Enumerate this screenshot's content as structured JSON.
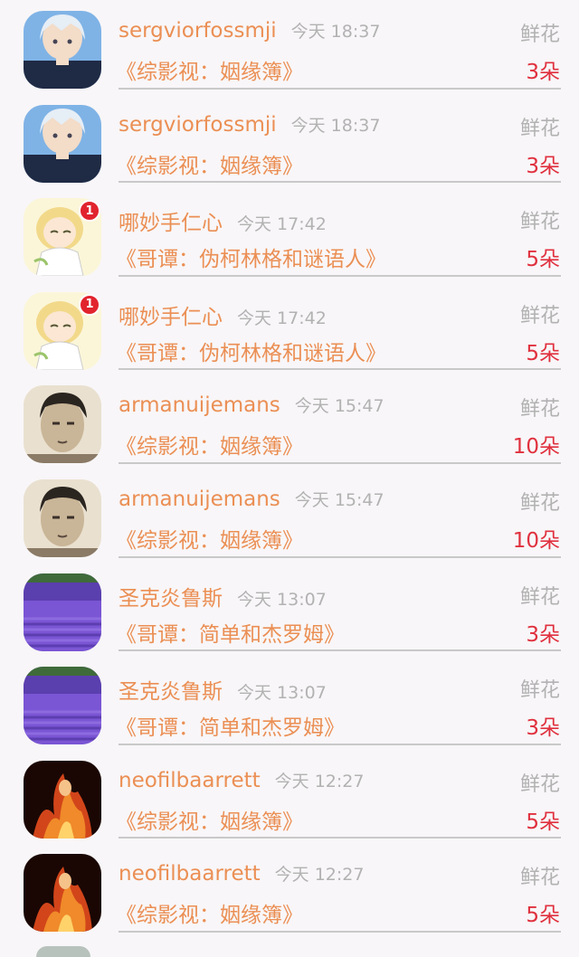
{
  "rows": [
    {
      "username": "sergviorfossmji",
      "time": "今天 18:37",
      "gift": "鲜花",
      "title": "《综影视：姻缘簿》",
      "count": "3朵",
      "avatar": "anime-boy-avatar"
    },
    {
      "username": "sergviorfossmji",
      "time": "今天 18:37",
      "gift": "鲜花",
      "title": "《综影视：姻缘簿》",
      "count": "3朵",
      "avatar": "anime-boy-avatar"
    },
    {
      "username": "哪妙手仁心",
      "time": "今天 17:42",
      "gift": "鲜花",
      "title": "《哥谭：伪柯林格和谜语人》",
      "count": "5朵",
      "avatar": "anime-girl-avatar",
      "badge": "1"
    },
    {
      "username": "哪妙手仁心",
      "time": "今天 17:42",
      "gift": "鲜花",
      "title": "《哥谭：伪柯林格和谜语人》",
      "count": "5朵",
      "avatar": "anime-girl-avatar",
      "badge": "1"
    },
    {
      "username": "armanuijemans",
      "time": "今天 15:47",
      "gift": "鲜花",
      "title": "《综影视：姻缘簿》",
      "count": "10朵",
      "avatar": "sketch-portrait-avatar"
    },
    {
      "username": "armanuijemans",
      "time": "今天 15:47",
      "gift": "鲜花",
      "title": "《综影视：姻缘簿》",
      "count": "10朵",
      "avatar": "sketch-portrait-avatar"
    },
    {
      "username": "圣克炎鲁斯",
      "time": "今天 13:07",
      "gift": "鲜花",
      "title": "《哥谭：简单和杰罗姆》",
      "count": "3朵",
      "avatar": "lavender-field-avatar"
    },
    {
      "username": "圣克炎鲁斯",
      "time": "今天 13:07",
      "gift": "鲜花",
      "title": "《哥谭：简单和杰罗姆》",
      "count": "3朵",
      "avatar": "lavender-field-avatar"
    },
    {
      "username": "neofilbaarrett",
      "time": "今天 12:27",
      "gift": "鲜花",
      "title": "《综影视：姻缘簿》",
      "count": "5朵",
      "avatar": "fire-figure-avatar"
    },
    {
      "username": "neofilbaarrett",
      "time": "今天 12:27",
      "gift": "鲜花",
      "title": "《综影视：姻缘簿》",
      "count": "5朵",
      "avatar": "fire-figure-avatar"
    }
  ]
}
